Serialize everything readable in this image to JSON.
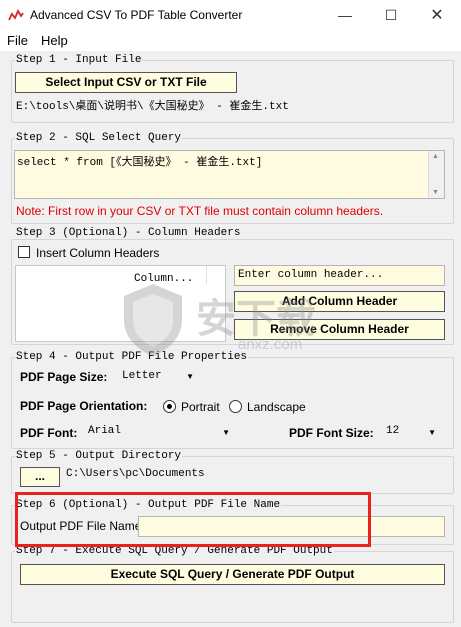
{
  "window": {
    "title": "Advanced CSV To PDF Table Converter",
    "minimize_glyph": "—",
    "maximize_glyph": "☐",
    "close_glyph": "✕"
  },
  "menu": {
    "file": "File",
    "help": "Help"
  },
  "step1": {
    "title": "Step 1 - Input File",
    "button": "Select Input CSV or TXT File",
    "path": "E:\\tools\\桌面\\说明书\\《大国秘史》 - 崔金生.txt"
  },
  "step2": {
    "title": "Step 2 - SQL Select Query",
    "query": "select * from [《大国秘史》 - 崔金生.txt]",
    "note": "Note: First row in your CSV or TXT file must contain column headers."
  },
  "step3": {
    "title": "Step 3 (Optional) - Column Headers",
    "checkbox_label": "Insert Column Headers",
    "list_header": "Column...",
    "input_placeholder": "Enter column header...",
    "add_button": "Add Column Header",
    "remove_button": "Remove Column Header"
  },
  "step4": {
    "title": "Step 4 - Output PDF File Properties",
    "page_size_label": "PDF Page Size:",
    "page_size_value": "Letter",
    "orientation_label": "PDF Page Orientation:",
    "portrait": "Portrait",
    "landscape": "Landscape",
    "font_label": "PDF Font:",
    "font_value": "Arial",
    "font_size_label": "PDF Font Size:",
    "font_size_value": "12"
  },
  "step5": {
    "title": "Step 5 - Output Directory",
    "browse_button": "...",
    "directory": "C:\\Users\\pc\\Documents"
  },
  "step6": {
    "title": "Step 6 (Optional) - Output PDF File Name",
    "label": "Output PDF File Name:",
    "value": ""
  },
  "step7": {
    "title": "Step 7 - Execute SQL Query / Generate PDF Output",
    "button": "Execute SQL Query / Generate PDF Output"
  },
  "watermark": {
    "text": "安下载",
    "subtext": "anxz.com"
  },
  "colors": {
    "highlight_box": "#e8231b",
    "field_bg": "#fefbe0",
    "note": "#e00000"
  }
}
